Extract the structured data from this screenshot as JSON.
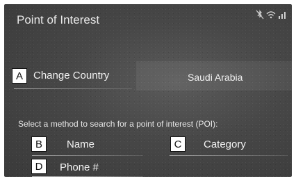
{
  "header": {
    "title": "Point of Interest"
  },
  "country": {
    "label": "Change Country",
    "value": "Saudi Arabia",
    "marker": "A"
  },
  "instruction": "Select a method to search for a point of interest (POI):",
  "methods": [
    {
      "marker": "B",
      "label": "Name"
    },
    {
      "marker": "C",
      "label": "Category"
    },
    {
      "marker": "D",
      "label": "Phone #"
    }
  ],
  "status_icons": [
    "bluetooth-off-icon",
    "wifi-icon",
    "signal-icon"
  ],
  "colors": {
    "screen_bg": "#474747",
    "text": "#f2f2f2",
    "marker_bg": "#ffffff",
    "marker_border": "#111111"
  }
}
